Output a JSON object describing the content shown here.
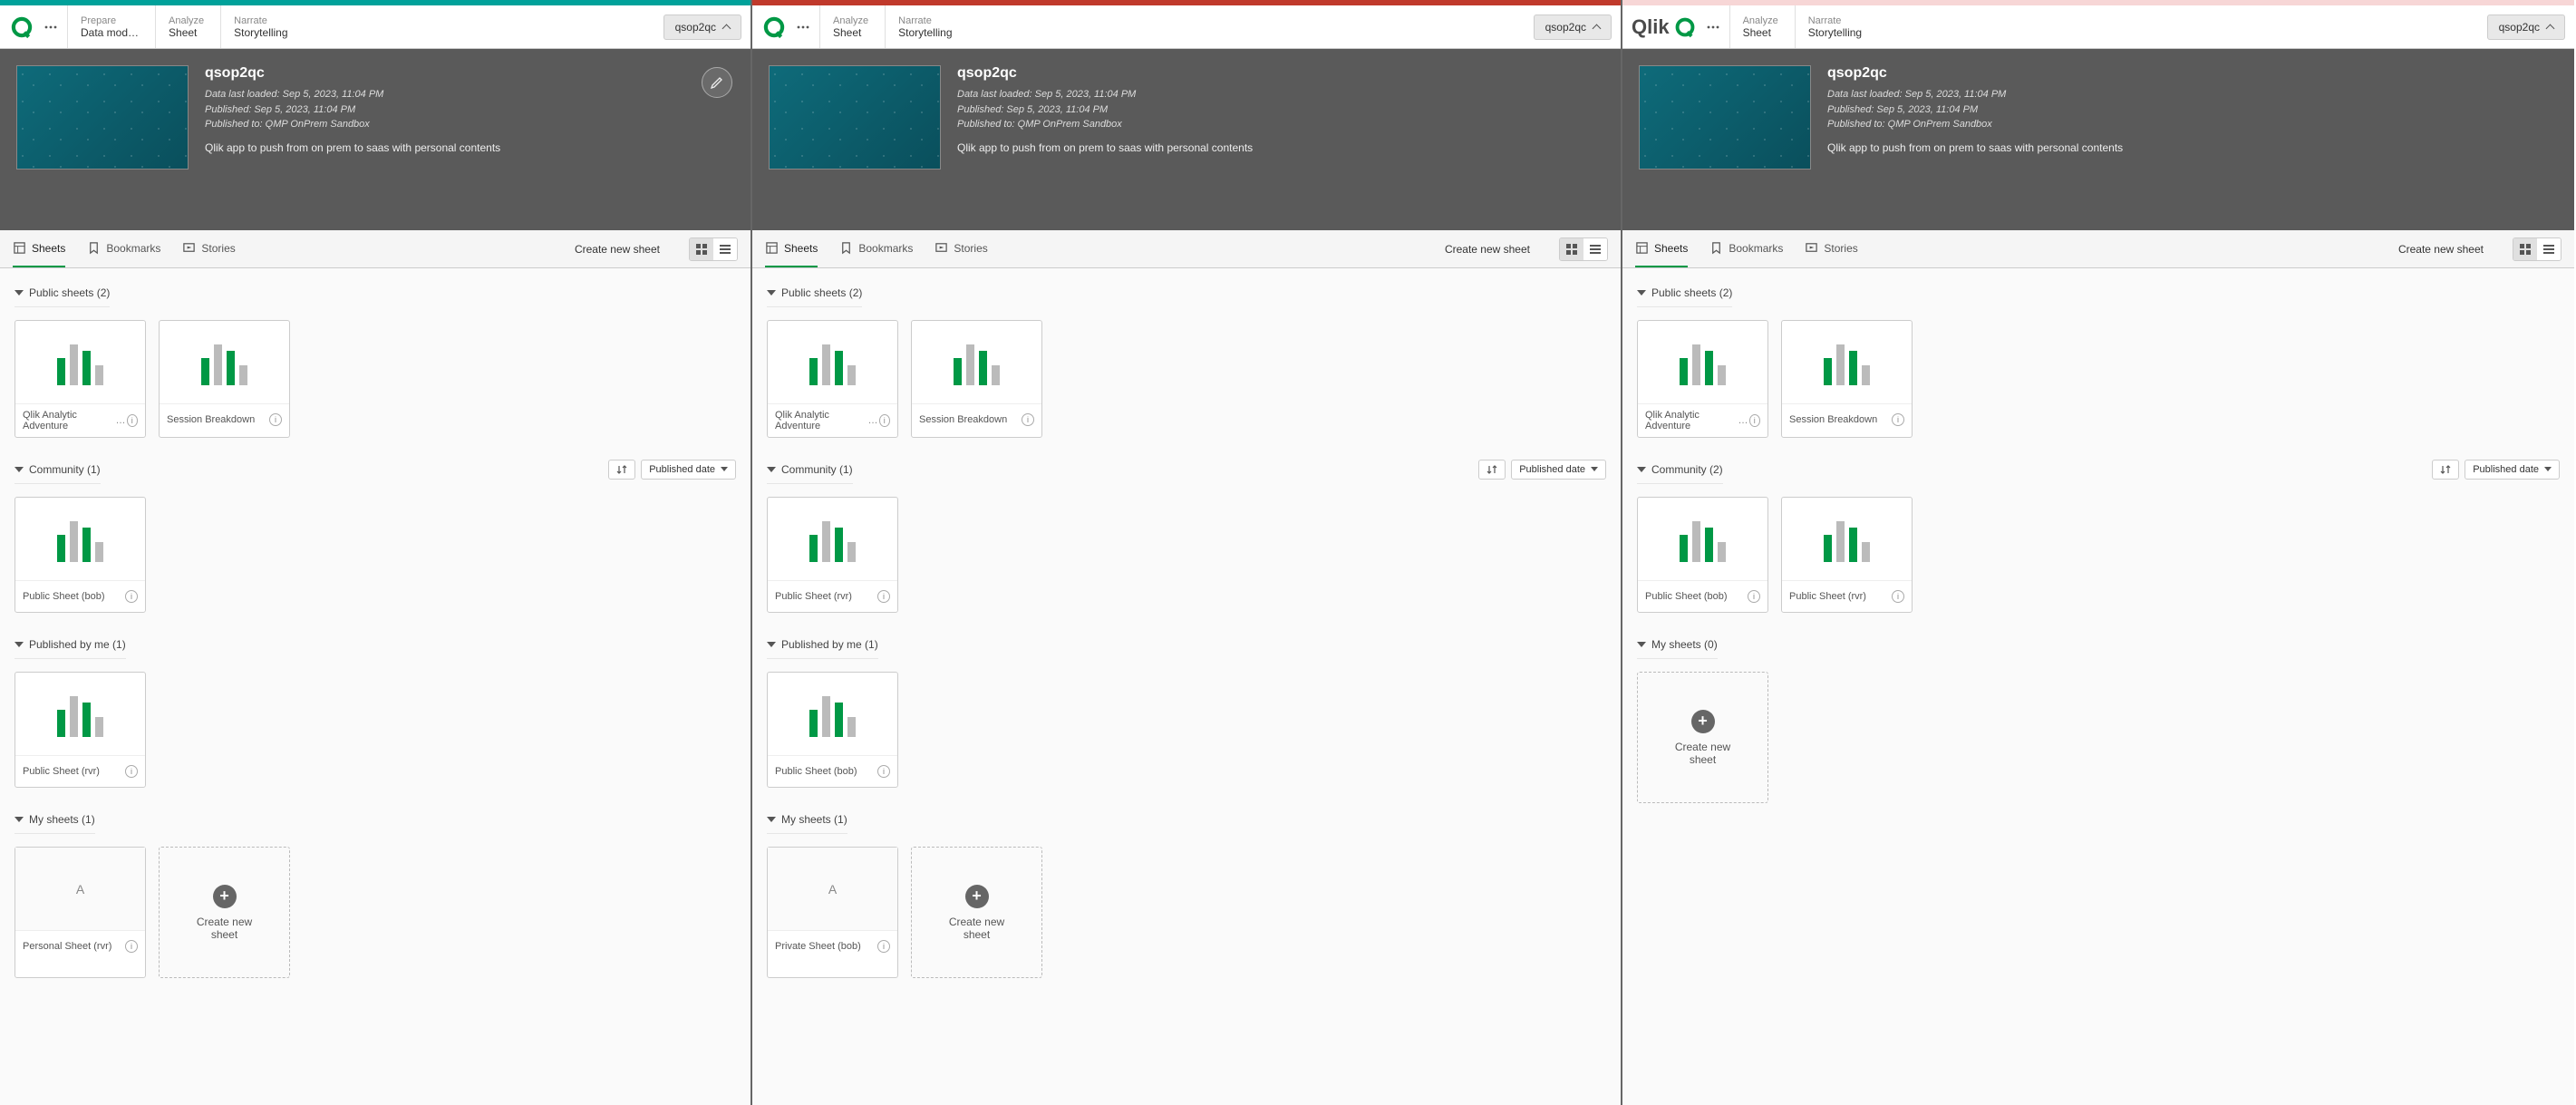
{
  "common": {
    "nav": {
      "prepare_small": "Prepare",
      "prepare_big": "Data mod…",
      "analyze_small": "Analyze",
      "analyze_big": "Sheet",
      "narrate_small": "Narrate",
      "narrate_big": "Storytelling"
    },
    "crumb": "qsop2qc",
    "app": {
      "title": "qsop2qc",
      "meta1": "Data last loaded: Sep 5, 2023, 11:04 PM",
      "meta2": "Published: Sep 5, 2023, 11:04 PM",
      "meta3": "Published to: QMP OnPrem Sandbox",
      "desc": "Qlik app to push from on prem to saas with personal contents"
    },
    "tabs": {
      "sheets": "Sheets",
      "bookmarks": "Bookmarks",
      "stories": "Stories"
    },
    "create_sheet": "Create new sheet",
    "create_new_sheet_card": "Create new sheet",
    "sort_label": "Published date"
  },
  "panels": [
    {
      "strip": "teal",
      "has_prepare": true,
      "logo": "q",
      "edit_btn": true,
      "sections": [
        {
          "title": "Public sheets (2)",
          "cards": [
            {
              "label": "Qlik Analytic Adventure",
              "more": true,
              "info": true
            },
            {
              "label": "Session Breakdown",
              "info": true
            }
          ]
        },
        {
          "title": "Community (1)",
          "sort": true,
          "cards": [
            {
              "label": "Public Sheet (bob)",
              "info": true
            }
          ]
        },
        {
          "title": "Published by me (1)",
          "cards": [
            {
              "label": "Public Sheet (rvr)",
              "info": true
            }
          ]
        },
        {
          "title": "My sheets (1)",
          "cards": [
            {
              "label": "Personal Sheet (rvr)",
              "blank": "A",
              "info": true
            },
            {
              "create": true
            }
          ]
        }
      ]
    },
    {
      "strip": "red",
      "has_prepare": false,
      "logo": "q",
      "edit_btn": false,
      "sections": [
        {
          "title": "Public sheets (2)",
          "cards": [
            {
              "label": "Qlik Analytic Adventure",
              "more": true,
              "info": true
            },
            {
              "label": "Session Breakdown",
              "info": true
            }
          ]
        },
        {
          "title": "Community (1)",
          "sort": true,
          "cards": [
            {
              "label": "Public Sheet (rvr)",
              "info": true
            }
          ]
        },
        {
          "title": "Published by me (1)",
          "cards": [
            {
              "label": "Public Sheet (bob)",
              "info": true
            }
          ]
        },
        {
          "title": "My sheets (1)",
          "cards": [
            {
              "label": "Private Sheet (bob)",
              "blank": "A",
              "info": true
            },
            {
              "create": true
            }
          ]
        }
      ]
    },
    {
      "strip": "pink",
      "has_prepare": false,
      "logo": "qlik",
      "edit_btn": false,
      "sections": [
        {
          "title": "Public sheets (2)",
          "cards": [
            {
              "label": "Qlik Analytic Adventure",
              "more": true,
              "info": true
            },
            {
              "label": "Session Breakdown",
              "info": true
            }
          ]
        },
        {
          "title": "Community (2)",
          "sort": true,
          "cards": [
            {
              "label": "Public Sheet (bob)",
              "info": true
            },
            {
              "label": "Public Sheet (rvr)",
              "info": true
            }
          ]
        },
        {
          "title": "My sheets (0)",
          "cards": [
            {
              "create": true
            }
          ]
        }
      ]
    }
  ]
}
